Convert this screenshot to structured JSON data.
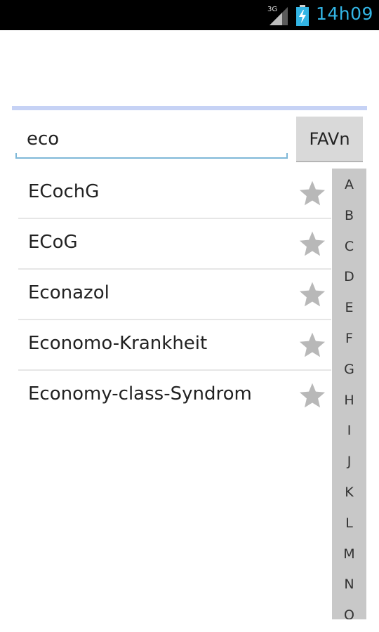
{
  "status_bar": {
    "network": "3G",
    "time": "14h09",
    "icons": [
      "signal-icon",
      "battery-charging-icon"
    ],
    "time_color": "#33b5e5"
  },
  "search": {
    "value": "eco",
    "fav_button_label": "FAVn"
  },
  "results": [
    {
      "label": "ECochG",
      "icon": "star-icon"
    },
    {
      "label": "ECoG",
      "icon": "star-icon"
    },
    {
      "label": "Econazol",
      "icon": "star-icon"
    },
    {
      "label": "Economo-Krankheit",
      "icon": "star-icon"
    },
    {
      "label": "Economy-class-Syndrom",
      "icon": "star-icon"
    }
  ],
  "alphabet_index": [
    "A",
    "B",
    "C",
    "D",
    "E",
    "F",
    "G",
    "H",
    "I",
    "J",
    "K",
    "L",
    "M",
    "N",
    "O"
  ],
  "colors": {
    "accent_divider": "#c6d2f5",
    "index_bar": "#c8c8c8",
    "star": "#b8b8b8"
  }
}
